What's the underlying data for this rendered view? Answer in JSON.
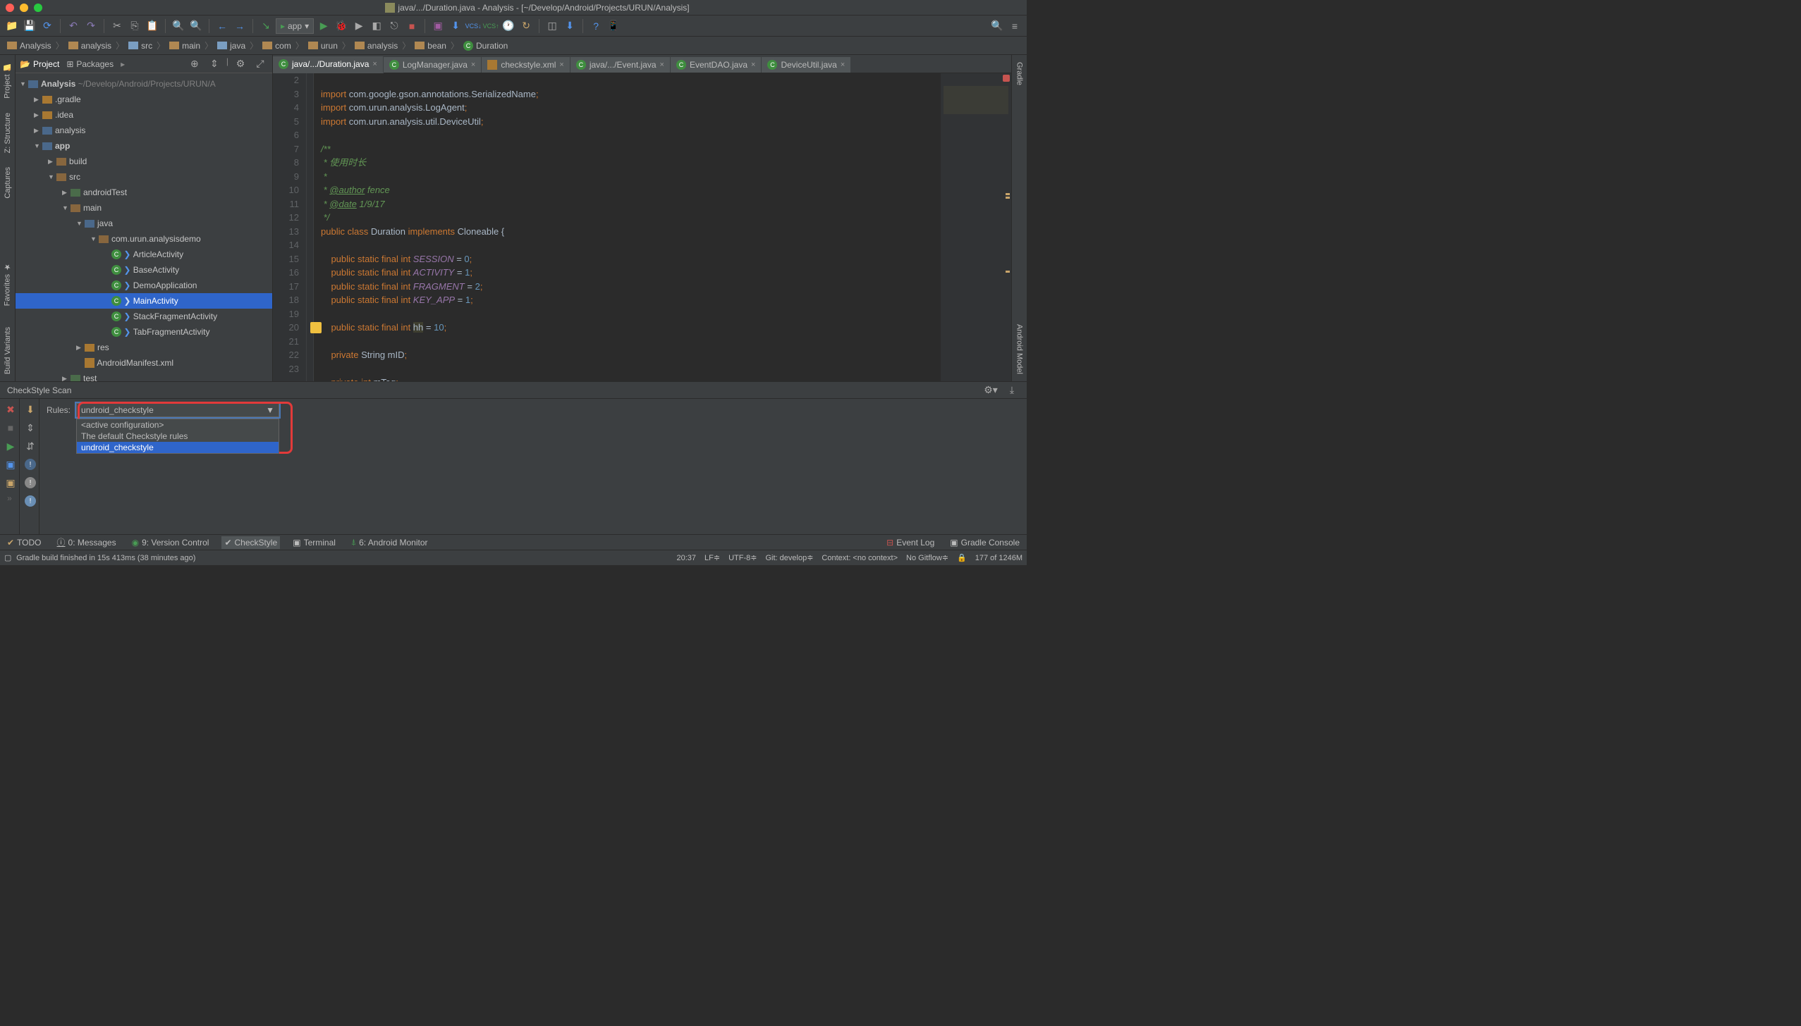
{
  "title": {
    "path": "java/.../Duration.java - Analysis - [~/Develop/Android/Projects/URUN/Analysis]"
  },
  "run_config": "app",
  "breadcrumbs": [
    "Analysis",
    "analysis",
    "src",
    "main",
    "java",
    "com",
    "urun",
    "analysis",
    "bean",
    "Duration"
  ],
  "project_tabs": {
    "project": "Project",
    "packages": "Packages"
  },
  "project_root": {
    "name": "Analysis",
    "path": "~/Develop/Android/Projects/URUN/A"
  },
  "tree": {
    "gradle": ".gradle",
    "idea": ".idea",
    "analysis": "analysis",
    "app": "app",
    "build": "build",
    "src": "src",
    "androidTest": "androidTest",
    "main": "main",
    "java": "java",
    "pkg": "com.urun.analysisdemo",
    "classes": [
      "ArticleActivity",
      "BaseActivity",
      "DemoApplication",
      "MainActivity",
      "StackFragmentActivity",
      "TabFragmentActivity"
    ],
    "res": "res",
    "manifest": "AndroidManifest.xml",
    "test": "test"
  },
  "editor_tabs": [
    {
      "label": "java/.../Duration.java",
      "icon": "java",
      "active": true
    },
    {
      "label": "LogManager.java",
      "icon": "java"
    },
    {
      "label": "checkstyle.xml",
      "icon": "xml"
    },
    {
      "label": "java/.../Event.java",
      "icon": "java"
    },
    {
      "label": "EventDAO.java",
      "icon": "java"
    },
    {
      "label": "DeviceUtil.java",
      "icon": "java"
    }
  ],
  "gutter_lines": [
    "2",
    "3",
    "4",
    "5",
    "6",
    "7",
    "8",
    "9",
    "10",
    "11",
    "12",
    "13",
    "14",
    "15",
    "16",
    "17",
    "18",
    "19",
    "20",
    "21",
    "22",
    "23"
  ],
  "code_html": [
    "",
    "<span class='k-orange'>import </span><span class='k-white'>com.google.gson.annotations.SerializedName</span><span class='k-orange'>;</span>",
    "<span class='k-orange'>import </span><span class='k-white'>com.urun.analysis.LogAgent</span><span class='k-orange'>;</span>",
    "<span class='k-orange'>import </span><span class='k-white'>com.urun.analysis.util.DeviceUtil</span><span class='k-orange'>;</span>",
    "",
    "<span class='k-comment'>/**</span>",
    "<span class='k-comment'> * 使用时长</span>",
    "<span class='k-comment'> *</span>",
    "<span class='k-comment'> * <span class='k-green-u'>@author</span> fence</span>",
    "<span class='k-comment'> * <span class='k-green-u'>@date</span> 1/9/17</span>",
    "<span class='k-comment'> */</span>",
    "<span class='k-orange'>public class </span><span class='k-white'>Duration </span><span class='k-orange'>implements </span><span class='k-white'>Cloneable {</span>",
    "",
    "    <span class='k-orange'>public static final int </span><span class='k-purple'>SESSION</span><span class='k-white'> = </span><span class='k-blue'>0</span><span class='k-orange'>;</span>",
    "    <span class='k-orange'>public static final int </span><span class='k-purple'>ACTIVITY</span><span class='k-white'> = </span><span class='k-blue'>1</span><span class='k-orange'>;</span>",
    "    <span class='k-orange'>public static final int </span><span class='k-purple'>FRAGMENT</span><span class='k-white'> = </span><span class='k-blue'>2</span><span class='k-orange'>;</span>",
    "    <span class='k-orange'>public static final int </span><span class='k-purple'>KEY_APP</span><span class='k-white'> = </span><span class='k-blue'>1</span><span class='k-orange'>;</span>",
    "",
    "    <span class='k-orange'>public static final int </span><span class='k-warn'>hh</span><span class='k-white'> = </span><span class='k-blue'>10</span><span class='k-orange'>;</span>",
    "",
    "    <span class='k-orange'>private </span><span class='k-white'>String mID</span><span class='k-orange'>;</span>",
    "",
    "    <span class='k-orange'>private int </span><span class='k-white'>mTag</span><span class='k-orange'>;</span>"
  ],
  "checkstyle": {
    "title": "CheckStyle Scan",
    "rules_label": "Rules:",
    "selected": "undroid_checkstyle",
    "options": [
      "<active configuration>",
      "The default Checkstyle rules",
      "undroid_checkstyle"
    ]
  },
  "bottom_tabs": {
    "todo": "TODO",
    "messages": "0: Messages",
    "vcs": "9: Version Control",
    "checkstyle": "CheckStyle",
    "terminal": "Terminal",
    "android": "6: Android Monitor",
    "eventlog": "Event Log",
    "gradleconsole": "Gradle Console"
  },
  "statusbar": {
    "msg": "Gradle build finished in 15s 413ms (38 minutes ago)",
    "pos": "20:37",
    "lf": "LF",
    "enc": "UTF-8",
    "git": "Git: develop",
    "context": "Context: <no context>",
    "gitflow": "No Gitflow",
    "lock": "",
    "mem": "177 of 1246M"
  },
  "left_rail": [
    "Project",
    "Z: Structure",
    "Captures",
    "Favorites",
    "Build Variants"
  ],
  "right_rail": [
    "Gradle",
    "Android Model"
  ]
}
